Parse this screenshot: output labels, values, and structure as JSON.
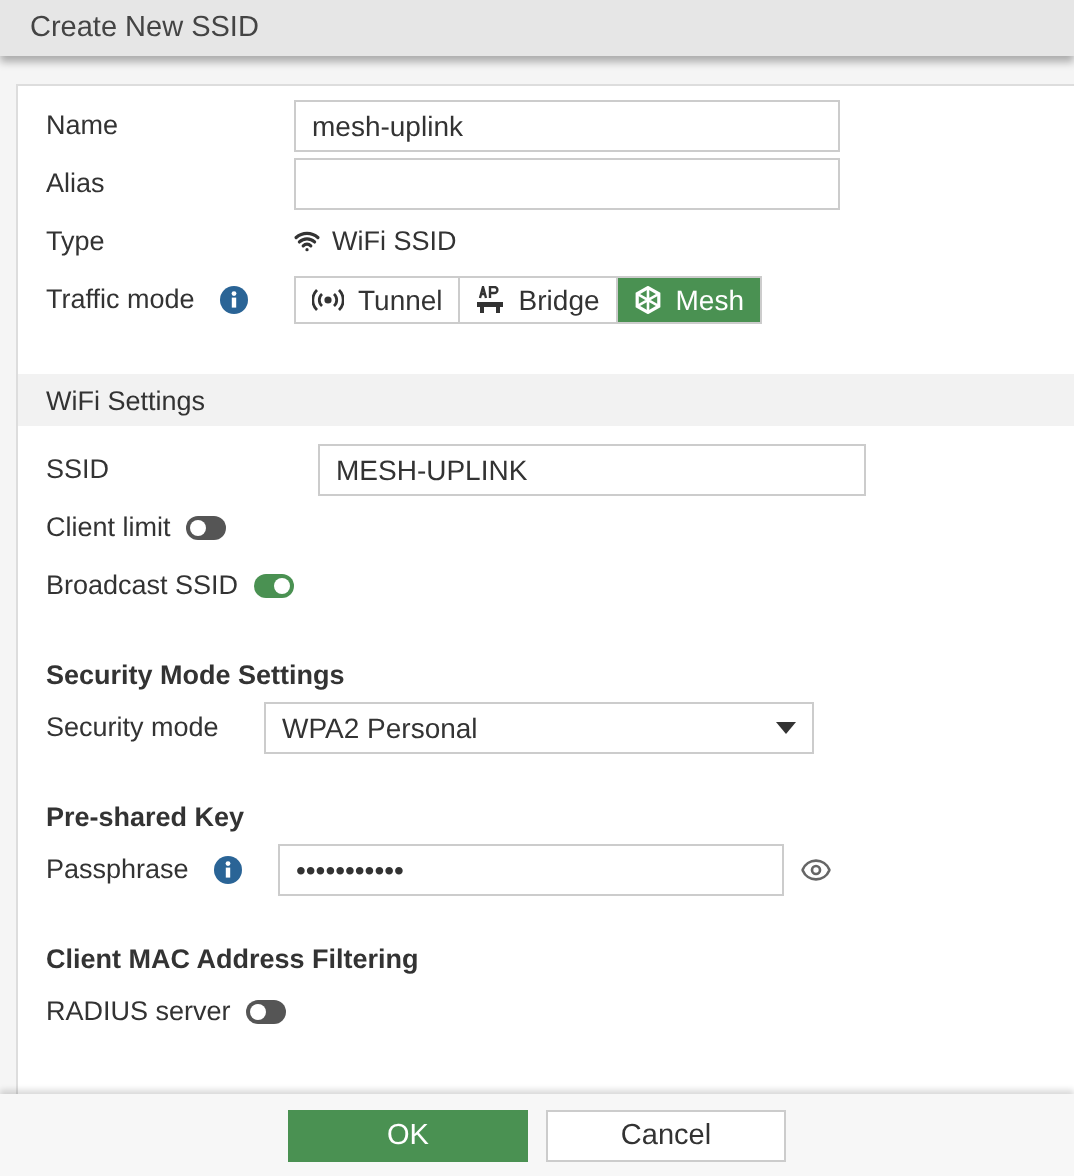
{
  "dialog": {
    "title": "Create New SSID"
  },
  "general": [
    {
      "kind": "input",
      "label": "Name",
      "value": "mesh-uplink"
    },
    {
      "kind": "input",
      "label": "Alias"
    },
    {
      "kind": "type",
      "label": "Type",
      "value": "WiFi SSID"
    },
    {
      "kind": "modes",
      "label": "Traffic mode",
      "info": true,
      "options": [
        {
          "kind": "tunnel",
          "label": "Tunnel",
          "selected": false
        },
        {
          "kind": "ap",
          "label": "Bridge",
          "selected": false
        },
        {
          "kind": "mesh",
          "label": "Mesh",
          "selected": true
        }
      ]
    }
  ],
  "sections": [
    {
      "kind": "band",
      "title": "WiFi Settings",
      "fields": [
        {
          "kind": "input",
          "label": "SSID",
          "value": "MESH-UPLINK"
        },
        {
          "kind": "toggle",
          "label": "Client limit",
          "on": false
        },
        {
          "kind": "toggle",
          "label": "Broadcast SSID",
          "on": true
        }
      ]
    },
    {
      "kind": "heading",
      "title": "Security Mode Settings",
      "fields": [
        {
          "kind": "select",
          "label": "Security mode",
          "value": "WPA2 Personal"
        }
      ]
    },
    {
      "kind": "heading",
      "title": "Pre-shared Key",
      "fields": [
        {
          "kind": "password",
          "label": "Passphrase",
          "info": true,
          "value": "•••••••••••"
        }
      ]
    },
    {
      "kind": "heading",
      "title": "Client MAC Address Filtering",
      "fields": [
        {
          "kind": "toggle",
          "label": "RADIUS server",
          "on": false
        }
      ]
    }
  ],
  "buttons": [
    {
      "label": "OK",
      "primary": true
    },
    {
      "label": "Cancel",
      "primary": false
    }
  ]
}
